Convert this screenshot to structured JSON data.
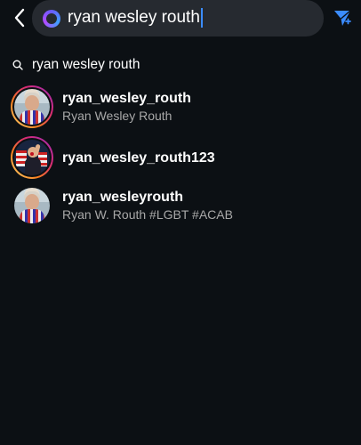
{
  "search": {
    "query": "ryan wesley routh"
  },
  "suggestion": {
    "text": "ryan wesley routh"
  },
  "results": [
    {
      "username": "ryan_wesley_routh",
      "fullname": "Ryan Wesley Routh",
      "story": true
    },
    {
      "username": "ryan_wesley_routh123",
      "fullname": "",
      "story": true
    },
    {
      "username": "ryan_wesleyrouth",
      "fullname": "Ryan W. Routh #LGBT #ACAB",
      "story": false
    }
  ],
  "colors": {
    "background": "#0c1014",
    "search_bg": "#262a30",
    "accent": "#3b8cff",
    "secondary_text": "#a8a8a8"
  },
  "icons": [
    "back-chevron-icon",
    "meta-ai-ring-icon",
    "send-icon",
    "search-icon"
  ]
}
